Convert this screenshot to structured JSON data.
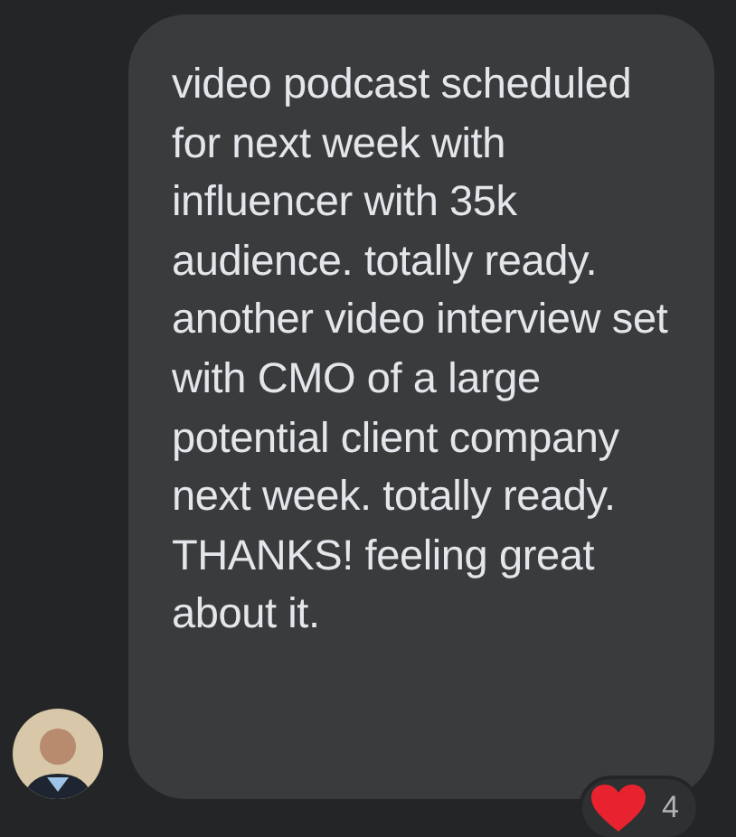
{
  "message": {
    "text": "video podcast scheduled for next week with influencer with 35k audience. totally ready. another video interview set with CMO of a large potential client company next week. totally ready. THANKS! feeling great about it.",
    "reaction": {
      "count": "4"
    }
  }
}
